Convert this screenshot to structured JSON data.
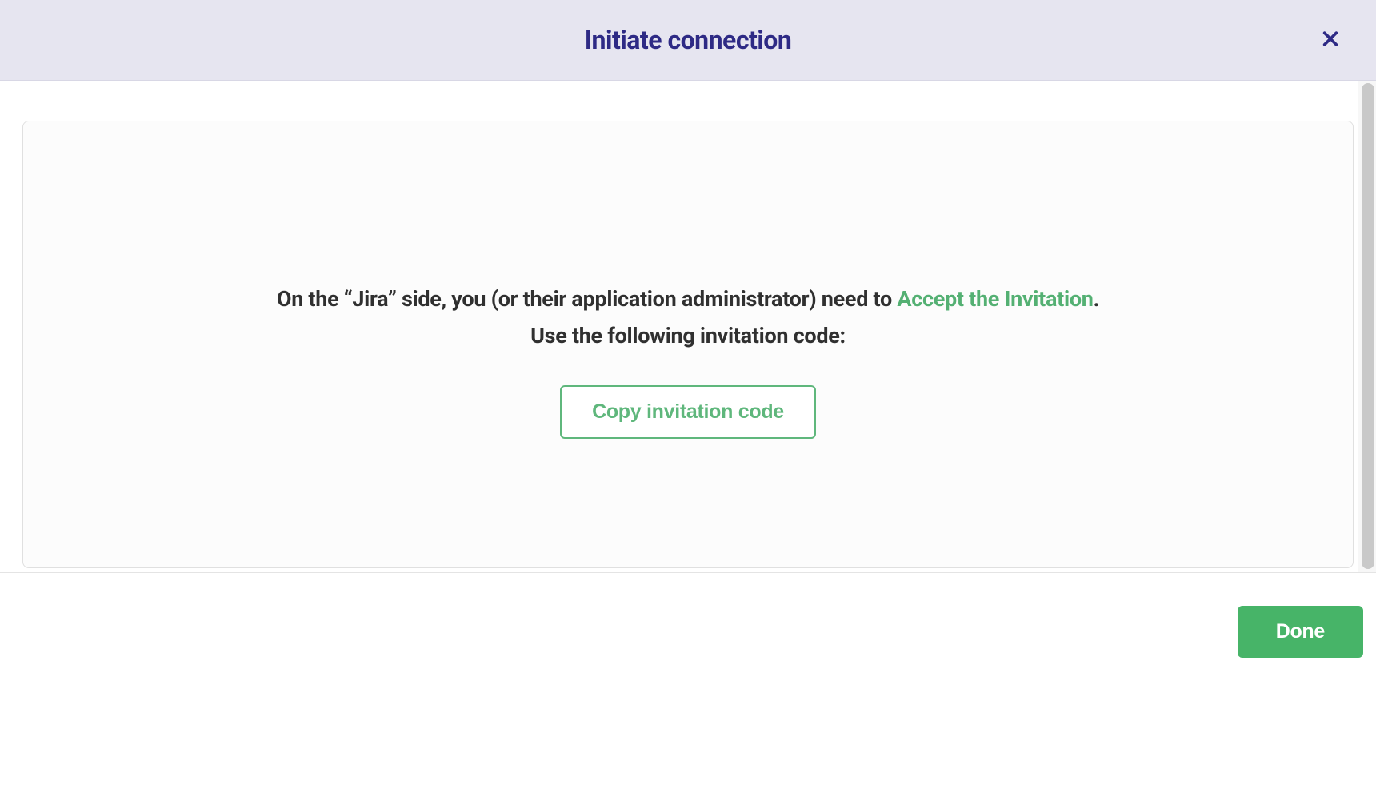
{
  "header": {
    "title": "Initiate connection"
  },
  "body": {
    "instruction_prefix": "On the “Jira” side, you (or their application administrator) need to ",
    "instruction_link": "Accept the Invitation",
    "instruction_suffix": ".",
    "secondary_instruction": "Use the following invitation code:",
    "copy_button_label": "Copy invitation code"
  },
  "footer": {
    "done_label": "Done"
  }
}
